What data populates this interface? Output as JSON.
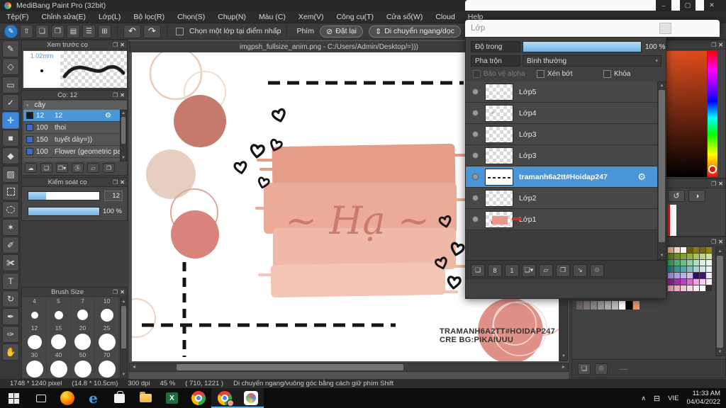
{
  "ui": {
    "popout": "❐",
    "close": "✕",
    "caret": "▾",
    "up": "▲",
    "down": "▼",
    "left": "◄",
    "right": "►",
    "gear": "⚙",
    "min": "–",
    "max": "▢",
    "chevron": "∧",
    "tray": "⊟",
    "undo": "↶",
    "redo": "↷",
    "dot": "●"
  },
  "window": {
    "title": "MediBang Paint Pro (32bit)"
  },
  "menu": {
    "items": [
      "Tệp(F)",
      "Chỉnh sửa(E)",
      "Lớp(L)",
      "Bộ lọc(R)",
      "Chọn(S)",
      "Chụp(N)",
      "Màu (C)",
      "Xem(V)",
      "Công cụ(T)",
      "Cửa sổ(W)",
      "Cloud",
      "Help"
    ]
  },
  "toolbar": {
    "icons": [
      {
        "glyph": "✎",
        "name": "snap-brush",
        "active": true
      },
      {
        "glyph": "⇧",
        "name": "upload"
      },
      {
        "glyph": "❏",
        "name": "comment"
      },
      {
        "glyph": "❐",
        "name": "comment-alt"
      },
      {
        "glyph": "▤",
        "name": "document"
      },
      {
        "glyph": "☰",
        "name": "material-list"
      },
      {
        "glyph": "⊞",
        "name": "grid"
      }
    ],
    "checkbox_label": "Chọn một lớp tại điểm nhấp",
    "key_label": "Phím",
    "reset_icon": "⊘",
    "reset_label": "Đặt lại",
    "move_icon": "⇕",
    "move_label": "Di chuyển ngang/dọc"
  },
  "tools": [
    {
      "glyph": "✎",
      "name": "brush-tool"
    },
    {
      "glyph": "◇",
      "name": "eraser-tool"
    },
    {
      "glyph": "▭",
      "name": "shape-tool"
    },
    {
      "glyph": "✓",
      "name": "curve-tool"
    },
    {
      "glyph": "✛",
      "name": "move-tool",
      "active": true
    },
    {
      "glyph": "■",
      "name": "fill-shape-tool"
    },
    {
      "glyph": "◆",
      "name": "bucket-tool"
    },
    {
      "glyph": "▨",
      "name": "gradient-tool"
    },
    {
      "glyph": "",
      "name": "select-tool",
      "marquee": true
    },
    {
      "glyph": "",
      "name": "lasso-tool",
      "lasso": true
    },
    {
      "glyph": "✶",
      "name": "magic-wand-tool"
    },
    {
      "glyph": "✐",
      "name": "select-pen-tool"
    },
    {
      "glyph": "✀",
      "name": "select-eraser-tool"
    },
    {
      "glyph": "T",
      "name": "text-tool"
    },
    {
      "glyph": "↻",
      "name": "rotate-tool"
    },
    {
      "glyph": "✒",
      "name": "divide-tool"
    },
    {
      "glyph": "✑",
      "name": "eyedropper-tool"
    },
    {
      "glyph": "✋",
      "name": "hand-tool"
    }
  ],
  "preview_panel": {
    "title": "Xem trước cọ",
    "size_label": "1.02mm"
  },
  "brush_panel": {
    "title": "Cọ: 12",
    "group_label": "cây",
    "rows": [
      {
        "chip": "#1a1a1a",
        "num": "12",
        "name": "12",
        "selected": true
      },
      {
        "chip": "#3f6bd0",
        "num": "100",
        "name": "thoi"
      },
      {
        "chip": "#3f6bd0",
        "num": "150",
        "name": "tuyết dày=))"
      },
      {
        "chip": "#3f6bd0",
        "num": "100",
        "name": "Flower (geometric patt"
      }
    ],
    "footer_icons": [
      {
        "glyph": "☁",
        "name": "cloud-download"
      },
      {
        "glyph": "❏",
        "name": "new-brush"
      },
      {
        "glyph": "❐▾",
        "name": "duplicate-brush-menu"
      },
      {
        "glyph": "Ⓢ",
        "name": "script-brush"
      },
      {
        "glyph": "▱",
        "name": "brush-folder"
      },
      {
        "glyph": "❐",
        "name": "copy-brush"
      }
    ]
  },
  "control_panel": {
    "title": "Kiểm soát cọ",
    "size_value": "12",
    "opacity_value": "100 %"
  },
  "size_panel": {
    "title": "Brush Size",
    "sizes": [
      {
        "label": "4",
        "d": 10
      },
      {
        "label": "5",
        "d": 12
      },
      {
        "label": "7",
        "d": 15
      },
      {
        "label": "10",
        "d": 18
      },
      {
        "label": "12",
        "d": 20
      },
      {
        "label": "15",
        "d": 21
      },
      {
        "label": "20",
        "d": 23
      },
      {
        "label": "25",
        "d": 24
      },
      {
        "label": "30",
        "d": 24
      },
      {
        "label": "40",
        "d": 24
      },
      {
        "label": "50",
        "d": 24
      },
      {
        "label": "70",
        "d": 24
      },
      {
        "d": 24
      },
      {
        "d": 24
      },
      {
        "d": 24
      },
      {
        "d": 24
      }
    ]
  },
  "canvas": {
    "tab_title": "imgpsh_fullsize_anim.png - C:/Users/Admin/Desktop/=)))",
    "artwork": {
      "title_text": "~ Hạ ~",
      "watermark_line1": "TRAMANH6A2TT#HOIDAP247",
      "watermark_line2": "CRE BG:PIKAIUUU"
    }
  },
  "layers_panel": {
    "title": "Lớp",
    "opacity_label": "Độ trong",
    "opacity_value": "100 %",
    "blend_label": "Pha trộn",
    "blend_value": "Bình thường",
    "alpha_label": "Bảo vệ alpha",
    "clip_label": "Xén bớt",
    "lock_label": "Khóa",
    "layers": [
      {
        "name": "Lớp5"
      },
      {
        "name": "Lớp4",
        "spots": true
      },
      {
        "name": "Lớp3"
      },
      {
        "name": "Lớp3"
      },
      {
        "name": "tramanh6a2tt#Hoidap247",
        "selected": true,
        "dash": true
      },
      {
        "name": "Lớp2"
      },
      {
        "name": "Lớp1",
        "art": true
      }
    ],
    "footer_icons": [
      {
        "glyph": "❏",
        "name": "add-layer"
      },
      {
        "glyph": "8",
        "name": "add-8bit-layer"
      },
      {
        "glyph": "1",
        "name": "add-1bit-layer"
      },
      {
        "glyph": "❏▾",
        "name": "add-special-layer"
      },
      {
        "glyph": "▱",
        "name": "layer-folder"
      },
      {
        "glyph": "❐",
        "name": "duplicate-layer"
      },
      {
        "glyph": "↘",
        "name": "transfer-layer"
      },
      {
        "glyph": "♲",
        "name": "delete-layer"
      }
    ]
  },
  "color_panels": {
    "swap_icon": "↺",
    "compare_icon": "◑",
    "new_icon": "❏",
    "trash_icon": "♲",
    "dashes": "----",
    "palette": [
      "#dfa77c",
      "#f2d7cb",
      "#fbf5ef",
      "#6b5c0b",
      "#8b7a12",
      "#756a0e",
      "#93830f",
      "#5a7a1a",
      "#6b8f24",
      "#7da22e",
      "#90b13f",
      "#a9c468",
      "#bcd488",
      "#cfe0a4",
      "#3a9a5e",
      "#53ab73",
      "#6fbc89",
      "#90cda5",
      "#b4dec2",
      "#d7eedd",
      "#ecf8f0",
      "#257d7d",
      "#3d9292",
      "#59a6a6",
      "#80bdbd",
      "#a9d3d3",
      "#d0e9e9",
      "#e9f5f5",
      "#9c8ede",
      "#aa9de5",
      "#b9afe9",
      "#c9c0ee",
      "#2c1061",
      "#3a1879",
      "#efecfa",
      "#8d208d",
      "#a52ca5",
      "#c03cc0",
      "#df69d1",
      "#efa5df",
      "#f7cdeb",
      "#fdf1f9",
      "#e497af",
      "#ecacbf",
      "#f4c3d1",
      "#f9dae3",
      "#fdedf1",
      "#ffffff",
      "#3a2b28"
    ],
    "small_swatches": [
      "#6b6366",
      "#7b7478",
      "#8c8689",
      "#9d989b",
      "#aeabad",
      "#c0bdbf",
      "#ffffff",
      "#000000",
      "#e89478"
    ]
  },
  "statusbar": {
    "dimensions": "1748 * 1240 pixel",
    "print_size": "(14.8 * 10.5cm)",
    "dpi": "300 dpi",
    "zoom": "45 %",
    "coords": "( 710, 1221 )",
    "hint": "Di chuyển ngang/vuông góc bằng cách giữ phím Shift"
  },
  "taskbar": {
    "language": "VIE",
    "time": "11:33 AM",
    "date": "04/04/2022",
    "edge_glyph": "e",
    "excel_glyph": "X"
  }
}
